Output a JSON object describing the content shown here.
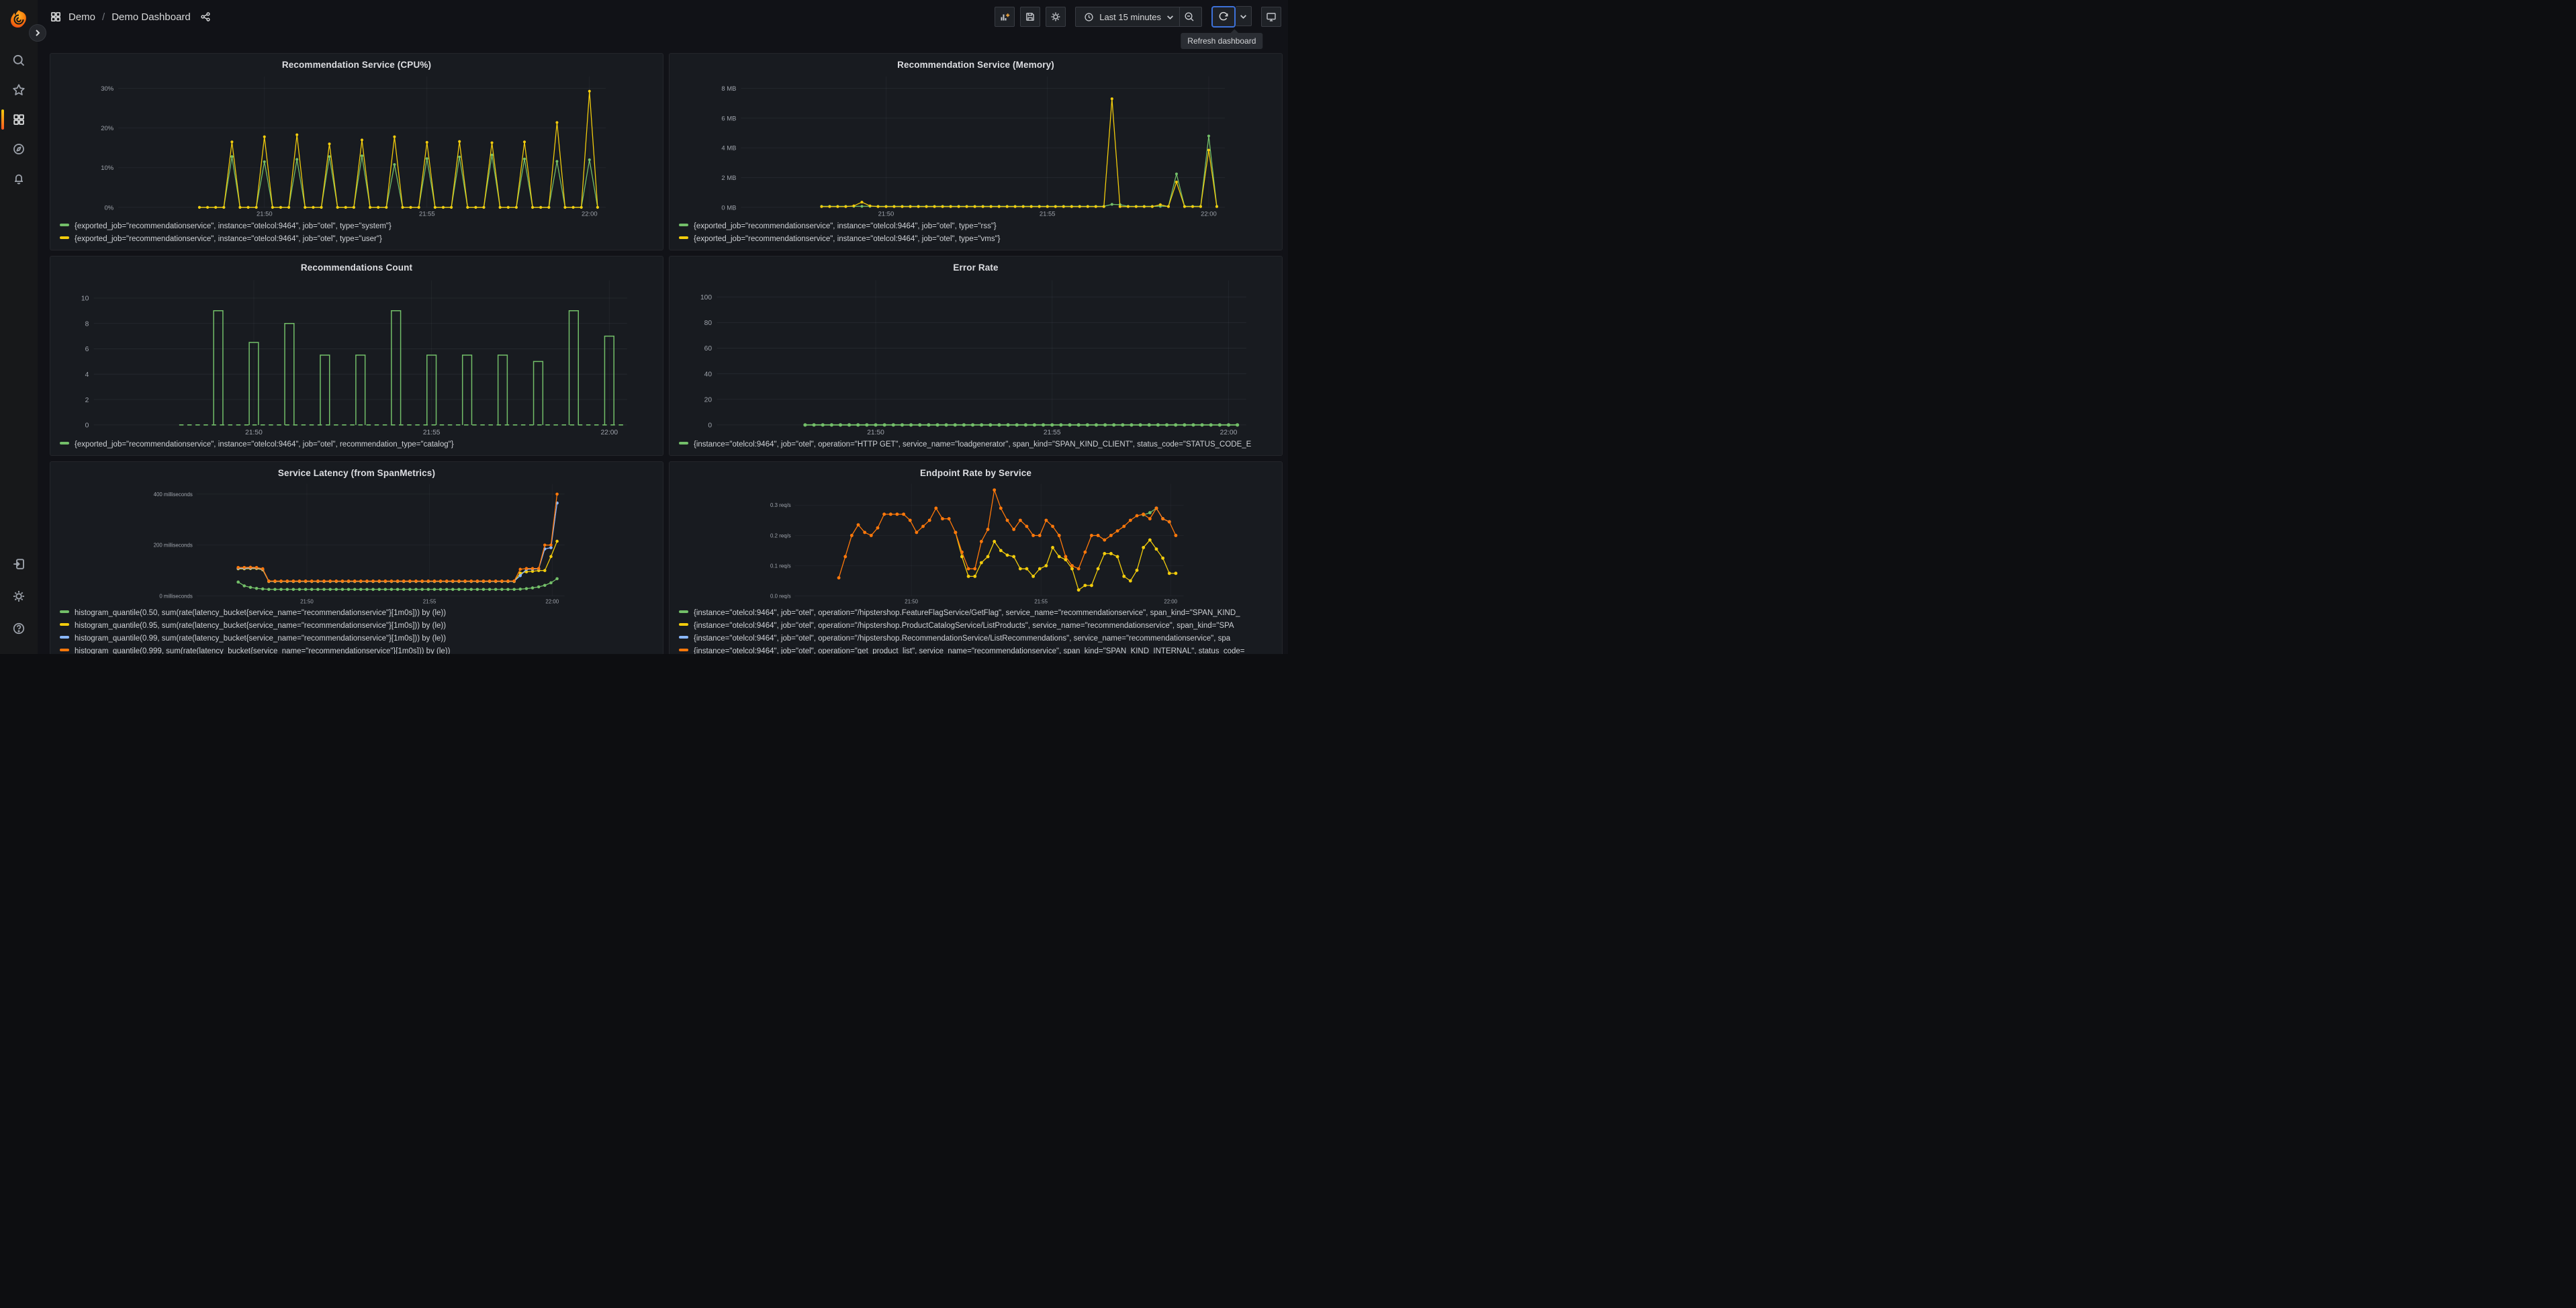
{
  "header": {
    "breadcrumb": {
      "icon": "apps-grid",
      "section": "Demo",
      "separator": "/",
      "title": "Demo Dashboard",
      "share_icon": "share-alt"
    }
  },
  "app": {
    "toolbar": {
      "buttons": [
        "add-panel",
        "save-dashboard",
        "dashboard-settings",
        "time-range-picker",
        "zoom-out",
        "refresh",
        "refresh-interval-dropdown",
        "cycle-view-mode"
      ],
      "time_range": "Last 15 minutes",
      "refresh_tooltip": "Refresh dashboard"
    }
  },
  "sidebar": {
    "top_items": [
      "search",
      "starred",
      "dashboards",
      "explore",
      "alerting"
    ],
    "active_item": "dashboards",
    "bottom_items": [
      "sign-in",
      "settings",
      "help"
    ]
  },
  "colors": {
    "green": "#73BF69",
    "yellow": "#F2CC0C",
    "blue": "#8AB8FF",
    "orange": "#FF780A",
    "focus_ring": "#3D71D9",
    "sidebar_active": "#FF7A33",
    "panel_bg": "#181B20"
  },
  "chart_data": [
    {
      "type": "line",
      "title": "Recommendation Service (CPU%)",
      "x_domain": [
        -1.5,
        13.5
      ],
      "x_ticks": [
        {
          "t": 3,
          "label": "21:50"
        },
        {
          "t": 8,
          "label": "21:55"
        },
        {
          "t": 13,
          "label": "22:00"
        }
      ],
      "y_domain": [
        0,
        33
      ],
      "y_ticks": [
        {
          "v": 0,
          "label": "0%"
        },
        {
          "v": 10,
          "label": "10%"
        },
        {
          "v": 20,
          "label": "20%"
        },
        {
          "v": 30,
          "label": "30%"
        }
      ],
      "line_width": 1.5,
      "point_radius": 2.4,
      "series": [
        {
          "label": "{exported_job=\"recommendationservice\", instance=\"otelcol:9464\", job=\"otel\", type=\"system\"}",
          "color": "#73BF69",
          "start": 1.0,
          "step": 0.25,
          "values": [
            0,
            0,
            0,
            0,
            12.8,
            0,
            0,
            0,
            11.5,
            0,
            0,
            0,
            12.1,
            0,
            0,
            0,
            12.8,
            0,
            0,
            0,
            13,
            0,
            0,
            0,
            10.8,
            0,
            0,
            0,
            12.3,
            0,
            0,
            0,
            12.7,
            0,
            0,
            0,
            13.2,
            0,
            0,
            0,
            12.2,
            0,
            0,
            0,
            11.6,
            0,
            0,
            0,
            12,
            0
          ]
        },
        {
          "label": "{exported_job=\"recommendationservice\", instance=\"otelcol:9464\", job=\"otel\", type=\"user\"}",
          "color": "#F2CC0C",
          "start": 1.0,
          "step": 0.25,
          "values": [
            0,
            0,
            0,
            0,
            16.5,
            0,
            0,
            0,
            17.8,
            0,
            0,
            0,
            18.3,
            0,
            0,
            0,
            16,
            0,
            0,
            0,
            17,
            0,
            0,
            0,
            17.8,
            0,
            0,
            0,
            16.4,
            0,
            0,
            0,
            16.6,
            0,
            0,
            0,
            16.3,
            0,
            0,
            0,
            16.5,
            0,
            0,
            0,
            21.4,
            0,
            0,
            0,
            29.3,
            0
          ]
        }
      ]
    },
    {
      "type": "line",
      "title": "Recommendation Service (Memory)",
      "x_domain": [
        -1.5,
        13.5
      ],
      "x_ticks": [
        {
          "t": 3,
          "label": "21:50"
        },
        {
          "t": 8,
          "label": "21:55"
        },
        {
          "t": 13,
          "label": "22:00"
        }
      ],
      "y_domain": [
        0,
        8.8
      ],
      "y_ticks": [
        {
          "v": 0,
          "label": "0 MB"
        },
        {
          "v": 2,
          "label": "2 MB"
        },
        {
          "v": 4,
          "label": "4 MB"
        },
        {
          "v": 6,
          "label": "6 MB"
        },
        {
          "v": 8,
          "label": "8 MB"
        }
      ],
      "line_width": 1.5,
      "point_radius": 2.4,
      "series": [
        {
          "label": "{exported_job=\"recommendationservice\", instance=\"otelcol:9464\", job=\"otel\", type=\"rss\"}",
          "color": "#73BF69",
          "start": 1.0,
          "step": 0.25,
          "values": [
            0.07,
            0.07,
            0.07,
            0.07,
            0.07,
            0.07,
            0.07,
            0.07,
            0.07,
            0.07,
            0.07,
            0.07,
            0.07,
            0.07,
            0.07,
            0.07,
            0.07,
            0.07,
            0.07,
            0.07,
            0.07,
            0.07,
            0.07,
            0.07,
            0.07,
            0.07,
            0.07,
            0.07,
            0.07,
            0.07,
            0.07,
            0.07,
            0.07,
            0.07,
            0.07,
            0.07,
            0.2,
            0.18,
            0.07,
            0.07,
            0.07,
            0.07,
            0.07,
            0.07,
            2.25,
            0.07,
            0.07,
            0.07,
            4.8,
            0.07
          ]
        },
        {
          "label": "{exported_job=\"recommendationservice\", instance=\"otelcol:9464\", job=\"otel\", type=\"vms\"}",
          "color": "#F2CC0C",
          "start": 1.0,
          "step": 0.25,
          "values": [
            0.05,
            0.05,
            0.05,
            0.05,
            0.1,
            0.35,
            0.1,
            0.05,
            0.05,
            0.05,
            0.05,
            0.05,
            0.05,
            0.05,
            0.05,
            0.05,
            0.05,
            0.05,
            0.05,
            0.05,
            0.05,
            0.05,
            0.05,
            0.05,
            0.05,
            0.05,
            0.05,
            0.05,
            0.05,
            0.05,
            0.05,
            0.05,
            0.05,
            0.05,
            0.05,
            0.05,
            7.3,
            0.05,
            0.05,
            0.05,
            0.05,
            0.05,
            0.18,
            0.05,
            1.7,
            0.05,
            0.05,
            0.05,
            3.85,
            0.05
          ]
        }
      ]
    },
    {
      "type": "pulse",
      "title": "Recommendations Count",
      "x_domain": [
        -1.5,
        13.5
      ],
      "x_ticks": [
        {
          "t": 3,
          "label": "21:50"
        },
        {
          "t": 8,
          "label": "21:55"
        },
        {
          "t": 13,
          "label": "22:00"
        }
      ],
      "y_domain": [
        0,
        11.4
      ],
      "y_ticks": [
        {
          "v": 0,
          "label": "0"
        },
        {
          "v": 2,
          "label": "2"
        },
        {
          "v": 4,
          "label": "4"
        },
        {
          "v": 6,
          "label": "6"
        },
        {
          "v": 8,
          "label": "8"
        },
        {
          "v": 10,
          "label": "10"
        }
      ],
      "pulse_width": 0.13,
      "series": [
        {
          "label": "{exported_job=\"recommendationservice\", instance=\"otelcol:9464\", job=\"otel\", recommendation_type=\"catalog\"}",
          "color": "#73BF69",
          "baseline_y": 0,
          "baseline": {
            "from": 0.9,
            "to": 13.45
          },
          "pulses": [
            [
              2,
              9
            ],
            [
              3,
              6.5
            ],
            [
              4,
              8
            ],
            [
              5,
              5.5
            ],
            [
              6,
              5.5
            ],
            [
              7,
              9
            ],
            [
              8,
              5.5
            ],
            [
              9,
              5.5
            ],
            [
              10,
              5.5
            ],
            [
              11,
              5
            ],
            [
              12,
              9
            ],
            [
              13,
              7
            ]
          ]
        }
      ]
    },
    {
      "type": "line",
      "title": "Error Rate",
      "x_domain": [
        -1.5,
        13.5
      ],
      "x_ticks": [
        {
          "t": 3,
          "label": "21:50"
        },
        {
          "t": 8,
          "label": "21:55"
        },
        {
          "t": 13,
          "label": "22:00"
        }
      ],
      "y_domain": [
        0,
        113
      ],
      "y_ticks": [
        {
          "v": 0,
          "label": "0"
        },
        {
          "v": 20,
          "label": "20"
        },
        {
          "v": 40,
          "label": "40"
        },
        {
          "v": 60,
          "label": "60"
        },
        {
          "v": 80,
          "label": "80"
        },
        {
          "v": 100,
          "label": "100"
        }
      ],
      "line_width": 2,
      "point_radius": 2.8,
      "series": [
        {
          "label": "{instance=\"otelcol:9464\", job=\"otel\", operation=\"HTTP GET\", service_name=\"loadgenerator\", span_kind=\"SPAN_KIND_CLIENT\", status_code=\"STATUS_CODE_E",
          "color": "#73BF69",
          "start": 1.0,
          "step": 0.25,
          "end": 13.25,
          "const": 0
        }
      ]
    },
    {
      "type": "line",
      "title": "Service Latency (from SpanMetrics)",
      "x_domain": [
        -1.5,
        13.5
      ],
      "x_ticks": [
        {
          "t": 3,
          "label": "21:50"
        },
        {
          "t": 8,
          "label": "21:55"
        },
        {
          "t": 13,
          "label": "22:00"
        }
      ],
      "y_domain": [
        0,
        440
      ],
      "y_ticks": [
        {
          "v": 0,
          "label": "0 milliseconds"
        },
        {
          "v": 200,
          "label": "200 milliseconds"
        },
        {
          "v": 400,
          "label": "400 milliseconds"
        }
      ],
      "line_width": 1.8,
      "point_radius": 3.2,
      "series": [
        {
          "label": "histogram_quantile(0.50, sum(rate(latency_bucket{service_name=\"recommendationservice\"}[1m0s])) by (le))",
          "color": "#73BF69",
          "start": 0.2,
          "step": 0.25,
          "values": [
            55,
            40,
            34,
            30,
            28,
            26,
            26,
            26,
            26,
            26,
            26,
            26,
            26,
            26,
            26,
            26,
            26,
            26,
            26,
            26,
            26,
            26,
            26,
            26,
            26,
            26,
            26,
            26,
            26,
            26,
            26,
            26,
            26,
            26,
            26,
            26,
            26,
            26,
            26,
            26,
            26,
            26,
            26,
            26,
            26,
            26,
            27,
            29,
            32,
            36,
            42,
            52,
            68
          ]
        },
        {
          "label": "histogram_quantile(0.95, sum(rate(latency_bucket{service_name=\"recommendationservice\"}[1m0s])) by (le))",
          "color": "#F2CC0C",
          "start": 0.2,
          "step": 0.25,
          "values": [
            107,
            107,
            108,
            108,
            103,
            57,
            57,
            57,
            57,
            57,
            57,
            57,
            57,
            57,
            57,
            57,
            57,
            57,
            57,
            57,
            57,
            57,
            57,
            57,
            57,
            57,
            57,
            57,
            57,
            57,
            57,
            57,
            57,
            57,
            57,
            57,
            57,
            57,
            57,
            57,
            57,
            57,
            57,
            57,
            57,
            57,
            90,
            95,
            97,
            100,
            100,
            155,
            215
          ]
        },
        {
          "label": "histogram_quantile(0.99, sum(rate(latency_bucket{service_name=\"recommendationservice\"}[1m0s])) by (le))",
          "color": "#8AB8FF",
          "start": 0.2,
          "step": 0.25,
          "values": [
            109,
            109,
            110,
            110,
            105,
            58,
            58,
            58,
            58,
            58,
            58,
            58,
            58,
            58,
            58,
            58,
            58,
            58,
            58,
            58,
            58,
            58,
            58,
            58,
            58,
            58,
            58,
            58,
            58,
            58,
            58,
            58,
            58,
            58,
            58,
            58,
            58,
            58,
            58,
            58,
            58,
            58,
            58,
            58,
            58,
            58,
            80,
            105,
            106,
            107,
            185,
            190,
            365
          ]
        },
        {
          "label": "histogram_quantile(0.999, sum(rate(latency_bucket{service_name=\"recommendationservice\"}[1m0s])) by (le))",
          "color": "#FF780A",
          "start": 0.2,
          "step": 0.25,
          "values": [
            112,
            112,
            113,
            112,
            107,
            59,
            59,
            59,
            59,
            59,
            59,
            59,
            59,
            59,
            59,
            59,
            59,
            59,
            59,
            59,
            59,
            59,
            59,
            59,
            59,
            59,
            59,
            59,
            59,
            59,
            59,
            59,
            59,
            59,
            59,
            59,
            59,
            59,
            59,
            59,
            59,
            59,
            59,
            59,
            59,
            59,
            105,
            108,
            108,
            108,
            200,
            200,
            400
          ]
        }
      ]
    },
    {
      "type": "line",
      "title": "Endpoint Rate by Service",
      "x_domain": [
        -1.5,
        13.5
      ],
      "x_ticks": [
        {
          "t": 3,
          "label": "21:50"
        },
        {
          "t": 8,
          "label": "21:55"
        },
        {
          "t": 13,
          "label": "22:00"
        }
      ],
      "y_domain": [
        0,
        0.37
      ],
      "y_ticks": [
        {
          "v": 0,
          "label": "0.0 req/s"
        },
        {
          "v": 0.1,
          "label": "0.1 req/s"
        },
        {
          "v": 0.2,
          "label": "0.2 req/s"
        },
        {
          "v": 0.3,
          "label": "0.3 req/s"
        }
      ],
      "line_width": 1.8,
      "point_radius": 3.4,
      "series": [
        {
          "label": "{instance=\"otelcol:9464\", job=\"otel\", operation=\"/hipstershop.FeatureFlagService/GetFlag\", service_name=\"recommendationservice\", span_kind=\"SPAN_KIND_",
          "color": "#73BF69",
          "points": [
            [
              11.95,
              0.268
            ],
            [
              12.2,
              0.275
            ],
            [
              12.45,
              0.29
            ]
          ]
        },
        {
          "label": "{instance=\"otelcol:9464\", job=\"otel\", operation=\"/hipstershop.ProductCatalogService/ListProducts\", service_name=\"recommendationservice\", span_kind=\"SPA",
          "color": "#F2CC0C",
          "start": 4.7,
          "step": 0.25,
          "values": [
            0.21,
            0.13,
            0.065,
            0.065,
            0.11,
            0.13,
            0.18,
            0.15,
            0.135,
            0.13,
            0.09,
            0.09,
            0.065,
            0.09,
            0.1,
            0.16,
            0.13,
            0.12,
            0.09,
            0.02,
            0.035,
            0.035,
            0.09,
            0.14,
            0.14,
            0.13,
            0.065,
            0.05,
            0.085,
            0.16,
            0.185,
            0.155,
            0.125,
            0.075,
            0.075
          ]
        },
        {
          "label": "{instance=\"otelcol:9464\", job=\"otel\", operation=\"/hipstershop.RecommendationService/ListRecommendations\", service_name=\"recommendationservice\", spa",
          "color": "#8AB8FF",
          "points": [
            [
              12.45,
              0.29
            ],
            [
              12.7,
              0.255
            ],
            [
              12.95,
              0.245
            ]
          ]
        },
        {
          "label": "{instance=\"otelcol:9464\", job=\"otel\", operation=\"get_product_list\", service_name=\"recommendationservice\", span_kind=\"SPAN_KIND_INTERNAL\", status_code=",
          "color": "#FF780A",
          "start": 0.2,
          "step": 0.25,
          "values": [
            0.06,
            0.13,
            0.2,
            0.235,
            0.21,
            0.2,
            0.225,
            0.27,
            0.27,
            0.27,
            0.27,
            0.25,
            0.21,
            0.23,
            0.25,
            0.29,
            0.255,
            0.255,
            0.21,
            0.145,
            0.09,
            0.09,
            0.18,
            0.22,
            0.35,
            0.29,
            0.25,
            0.22,
            0.25,
            0.23,
            0.2,
            0.2,
            0.25,
            0.23,
            0.2,
            0.13,
            0.1,
            0.09,
            0.145,
            0.2,
            0.2,
            0.185,
            0.2,
            0.215,
            0.23,
            0.25,
            0.265,
            0.27,
            0.255,
            0.29,
            0.255,
            0.245,
            0.2
          ]
        }
      ]
    }
  ]
}
